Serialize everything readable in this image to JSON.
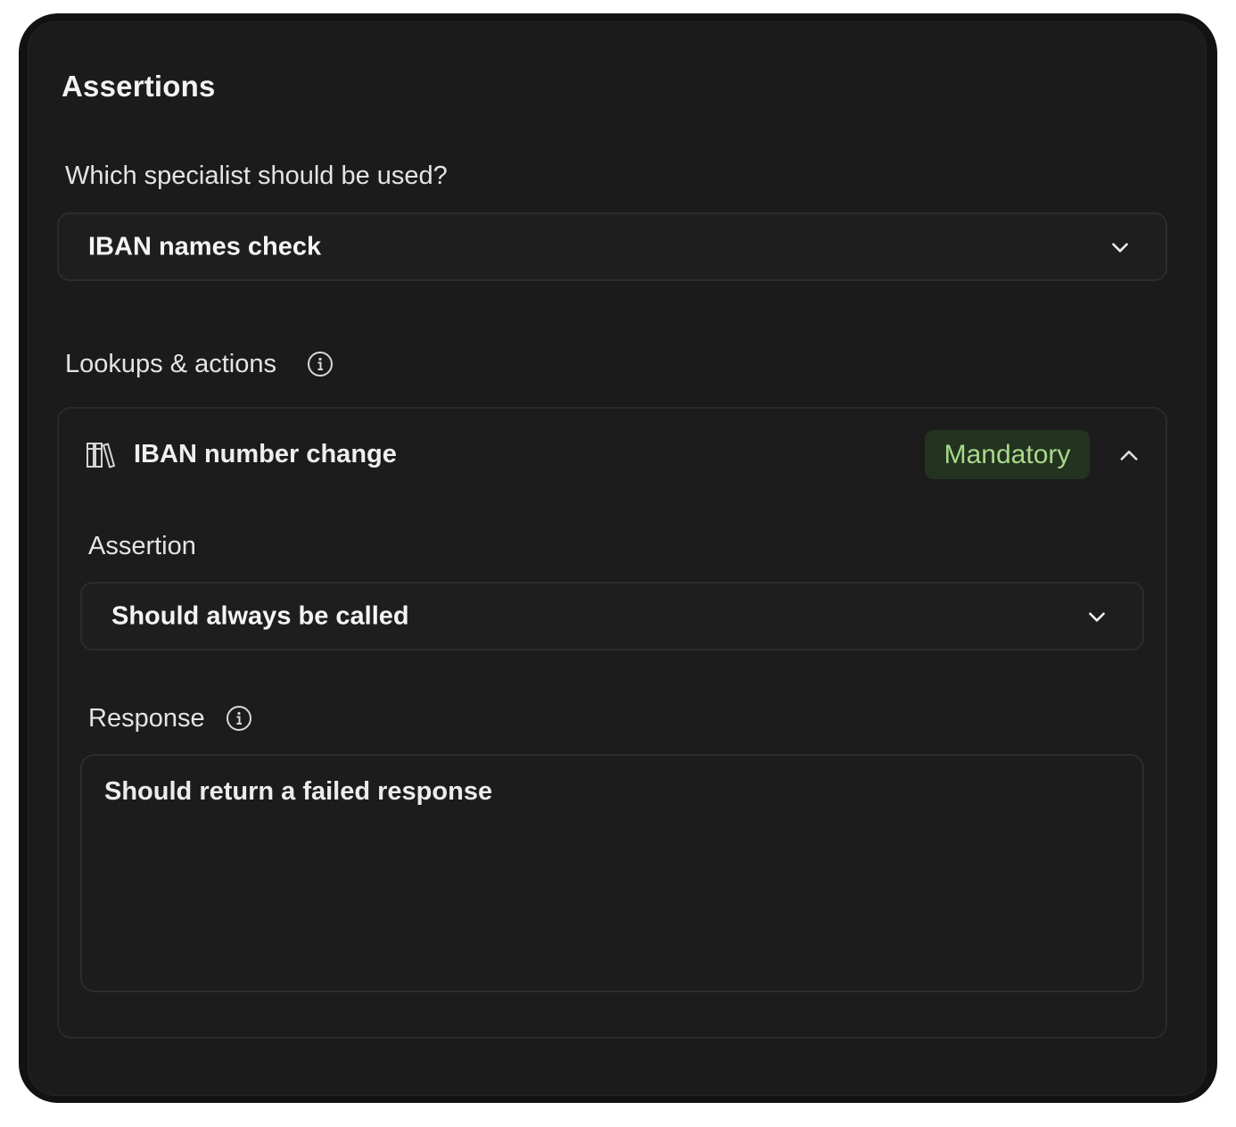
{
  "header": {
    "title": "Assertions"
  },
  "specialist": {
    "question": "Which specialist should be used?",
    "selected": "IBAN names check",
    "chevron_icon": "chevron-down-icon"
  },
  "lookups": {
    "label": "Lookups & actions",
    "info_icon": "info-icon",
    "item": {
      "icon": "library-books-icon",
      "name": "IBAN number change",
      "badge": "Mandatory",
      "badge_color": "#a8d98a",
      "collapse_icon": "chevron-up-icon",
      "assertion_label": "Assertion",
      "assertion_value": "Should always be called",
      "response_label": "Response",
      "response_value": "Should return a failed response"
    }
  },
  "colors": {
    "background": "#1b1b1b",
    "frame": "#121212",
    "badge_bg": "#243320"
  }
}
